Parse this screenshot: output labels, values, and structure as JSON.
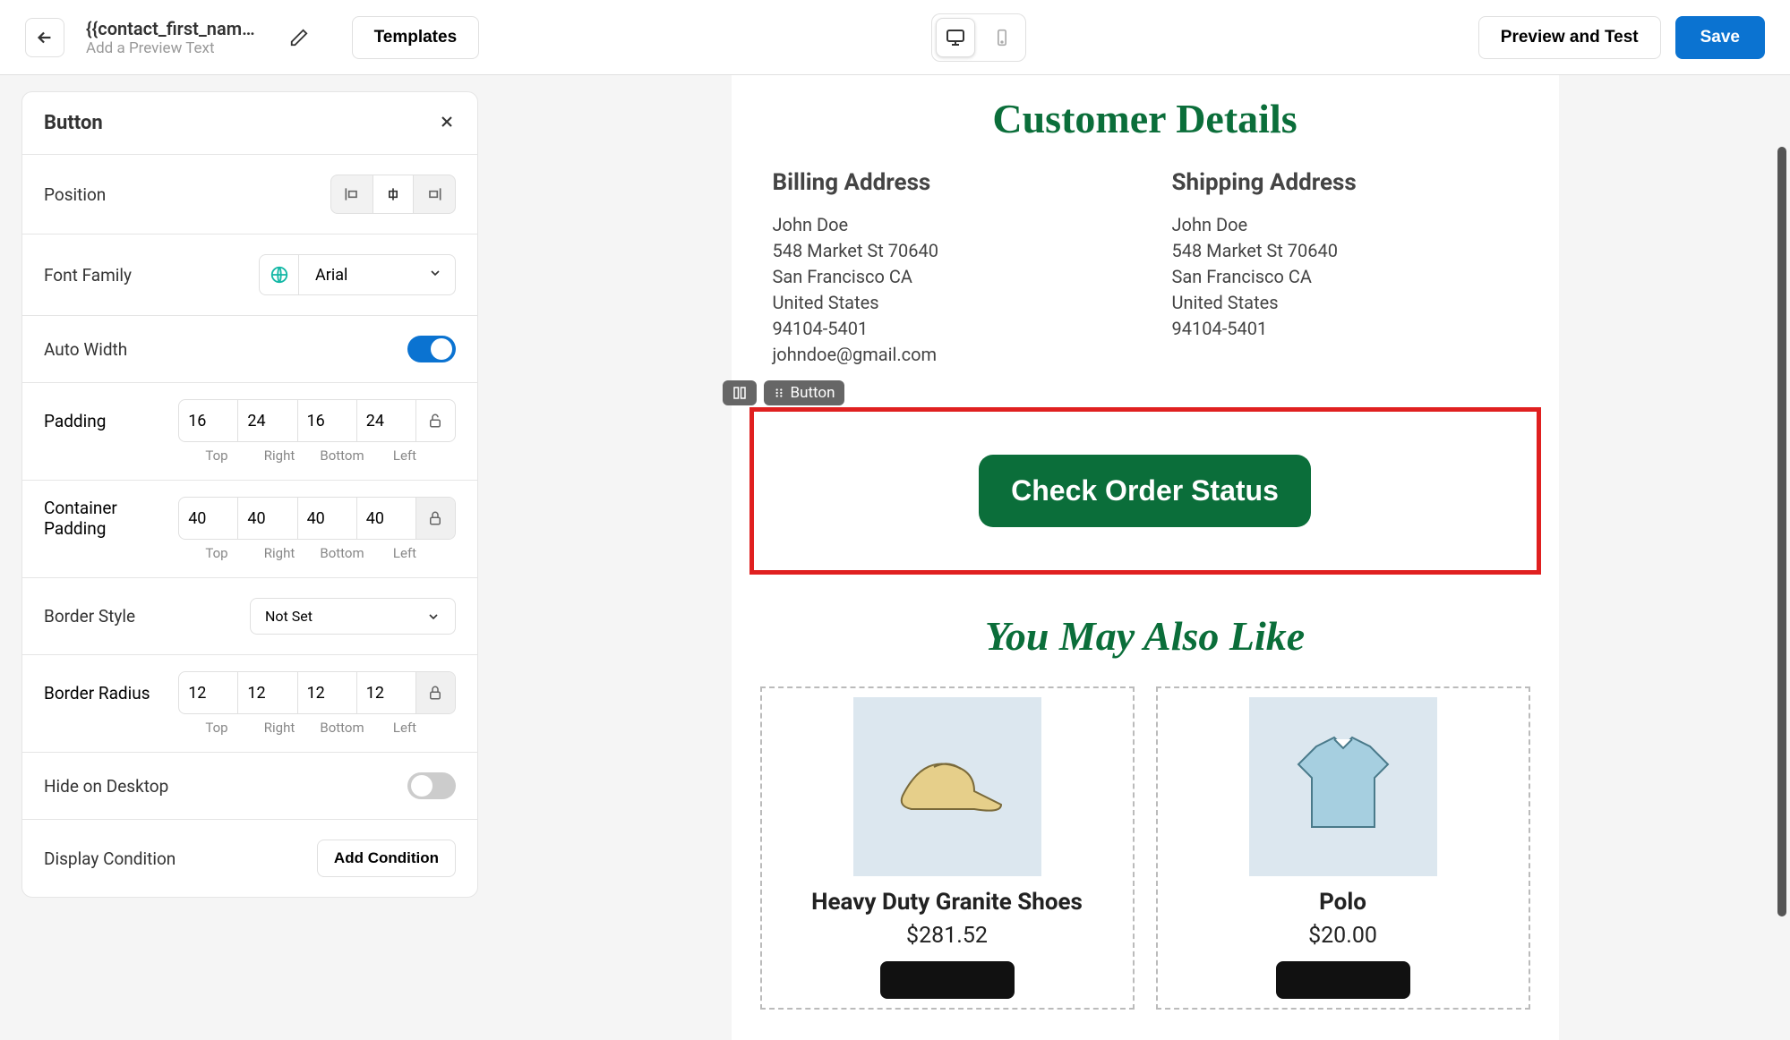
{
  "header": {
    "title": "{{contact_first_nam…",
    "subtitle": "Add a Preview Text",
    "templates_btn": "Templates",
    "preview_btn": "Preview and Test",
    "save_btn": "Save"
  },
  "panel": {
    "title": "Button",
    "position_label": "Position",
    "font_family_label": "Font Family",
    "font_family_value": "Arial",
    "auto_width_label": "Auto Width",
    "auto_width_on": true,
    "padding_label": "Padding",
    "padding": {
      "top": "16",
      "right": "24",
      "bottom": "16",
      "left": "24"
    },
    "padding_caps": {
      "top": "Top",
      "right": "Right",
      "bottom": "Bottom",
      "left": "Left"
    },
    "container_padding_label": "Container Padding",
    "container_padding": {
      "top": "40",
      "right": "40",
      "bottom": "40",
      "left": "40"
    },
    "border_style_label": "Border Style",
    "border_style_value": "Not Set",
    "border_radius_label": "Border Radius",
    "border_radius": {
      "top": "12",
      "right": "12",
      "bottom": "12",
      "left": "12"
    },
    "hide_desktop_label": "Hide on Desktop",
    "hide_desktop_on": false,
    "display_condition_label": "Display Condition",
    "add_condition_btn": "Add Condition"
  },
  "canvas": {
    "customer_details_heading": "Customer Details",
    "billing": {
      "title": "Billing Address",
      "name": "John Doe",
      "street": "548 Market St 70640",
      "city": "San Francisco CA",
      "country": "United States",
      "zip": "94104-5401",
      "email": "johndoe@gmail.com"
    },
    "shipping": {
      "title": "Shipping Address",
      "name": "John Doe",
      "street": "548 Market St 70640",
      "city": "San Francisco CA",
      "country": "United States",
      "zip": "94104-5401"
    },
    "block_tag": "Button",
    "cta_label": "Check Order Status",
    "also_like_heading": "You May Also Like",
    "products": [
      {
        "name": "Heavy Duty Granite Shoes",
        "price": "$281.52"
      },
      {
        "name": "Polo",
        "price": "$20.00"
      }
    ]
  }
}
